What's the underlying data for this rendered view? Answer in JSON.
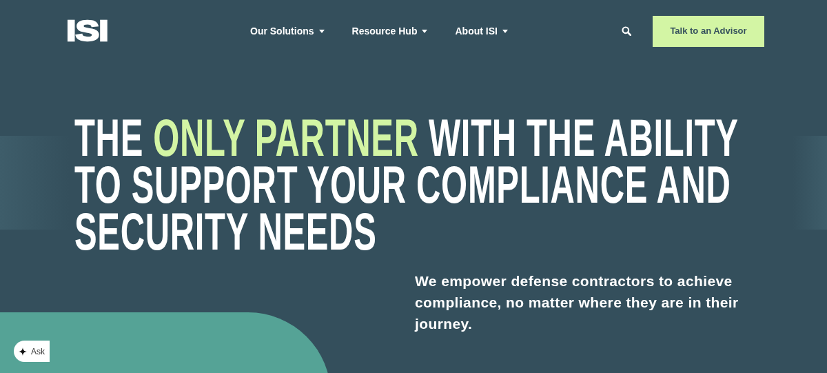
{
  "logo": "ISI",
  "nav": [
    {
      "label": "Our Solutions",
      "has_menu": true
    },
    {
      "label": "Resource Hub",
      "has_menu": true
    },
    {
      "label": "About ISI",
      "has_menu": true
    }
  ],
  "cta": "Talk to an Advisor",
  "headline_lines": [
    [
      {
        "text": "THE ",
        "highlight": false
      },
      {
        "text": "ONLY PARTNER",
        "highlight": true
      },
      {
        "text": " WITH THE ABILITY",
        "highlight": false
      }
    ],
    [
      {
        "text": "TO SUPPORT YOUR COMPLIANCE AND",
        "highlight": false
      }
    ],
    [
      {
        "text": "SECURITY NEEDS",
        "highlight": false
      }
    ]
  ],
  "subheading": "We empower defense contractors to achieve compliance, no matter where they are in their journey.",
  "chat_widget": {
    "label": "Ask"
  }
}
